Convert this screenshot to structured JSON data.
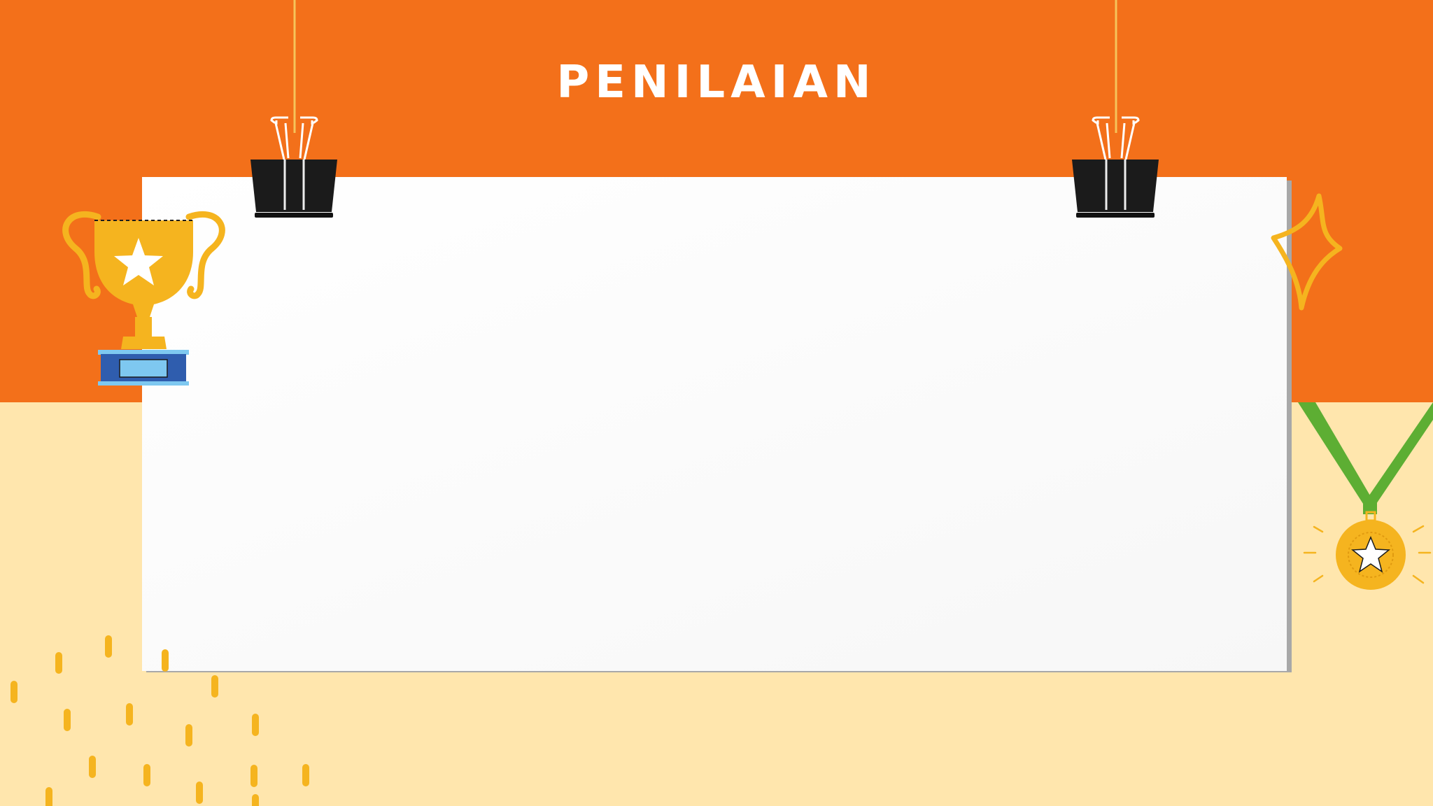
{
  "slide": {
    "title": "PENILAIAN"
  },
  "colors": {
    "top_band": "#F3701A",
    "background": "#FFE6AD",
    "board": "#FFFFFF",
    "accent_yellow": "#F5B41F",
    "ribbon_green": "#5DAE33",
    "clip_black": "#1B1B1B",
    "trophy_base_blue": "#2F5DAE"
  },
  "decorations": {
    "icons": [
      "binder-clip-icon",
      "binder-clip-icon",
      "trophy-icon",
      "sparkle-icon",
      "medal-icon",
      "dash-pattern"
    ]
  }
}
